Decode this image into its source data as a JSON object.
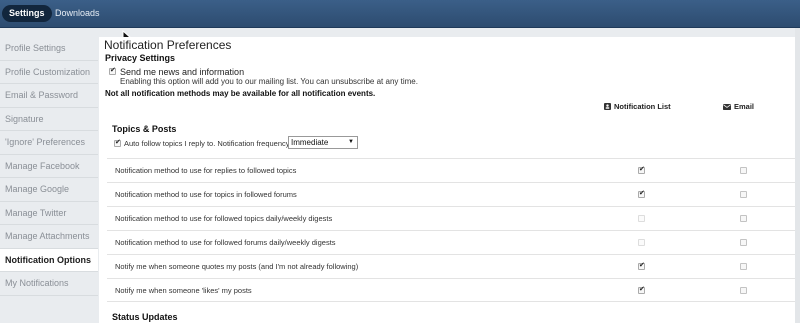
{
  "topbar": {
    "tabs": [
      "Settings",
      "Downloads"
    ]
  },
  "sidebar": {
    "items": [
      "Profile Settings",
      "Profile Customization",
      "Email & Password",
      "Signature",
      "'Ignore' Preferences",
      "Manage Facebook",
      "Manage Google",
      "Manage Twitter",
      "Manage Attachments",
      "Notification Options",
      "My Notifications"
    ],
    "active": "Notification Options"
  },
  "main": {
    "title": "Notification Preferences",
    "privacy": {
      "heading": "Privacy Settings",
      "newsletter_label": "Send me news and information",
      "newsletter_help": "Enabling this option will add you to our mailing list. You can unsubscribe at any time.",
      "newsletter_checked": true
    },
    "methods_note": "Not all notification methods may be available for all notification events.",
    "columns": {
      "list": "Notification List",
      "email": "Email"
    },
    "topics": {
      "heading": "Topics & Posts",
      "auto_follow_label": "Auto follow topics I reply to. Notification frequency:",
      "auto_follow_checked": true,
      "frequency": "Immediate"
    },
    "rows": [
      {
        "label": "Notification method to use for replies to followed topics",
        "list": "checked",
        "email": "unchecked"
      },
      {
        "label": "Notification method to use for topics in followed forums",
        "list": "checked",
        "email": "unchecked"
      },
      {
        "label": "Notification method to use for followed topics daily/weekly digests",
        "list": "disabled",
        "email": "unchecked"
      },
      {
        "label": "Notification method to use for followed forums daily/weekly digests",
        "list": "disabled",
        "email": "unchecked"
      },
      {
        "label": "Notify me when someone quotes my posts (and I'm not already following)",
        "list": "checked",
        "email": "unchecked"
      },
      {
        "label": "Notify me when someone 'likes' my posts",
        "list": "checked",
        "email": "unchecked"
      }
    ],
    "status_heading": "Status Updates"
  }
}
